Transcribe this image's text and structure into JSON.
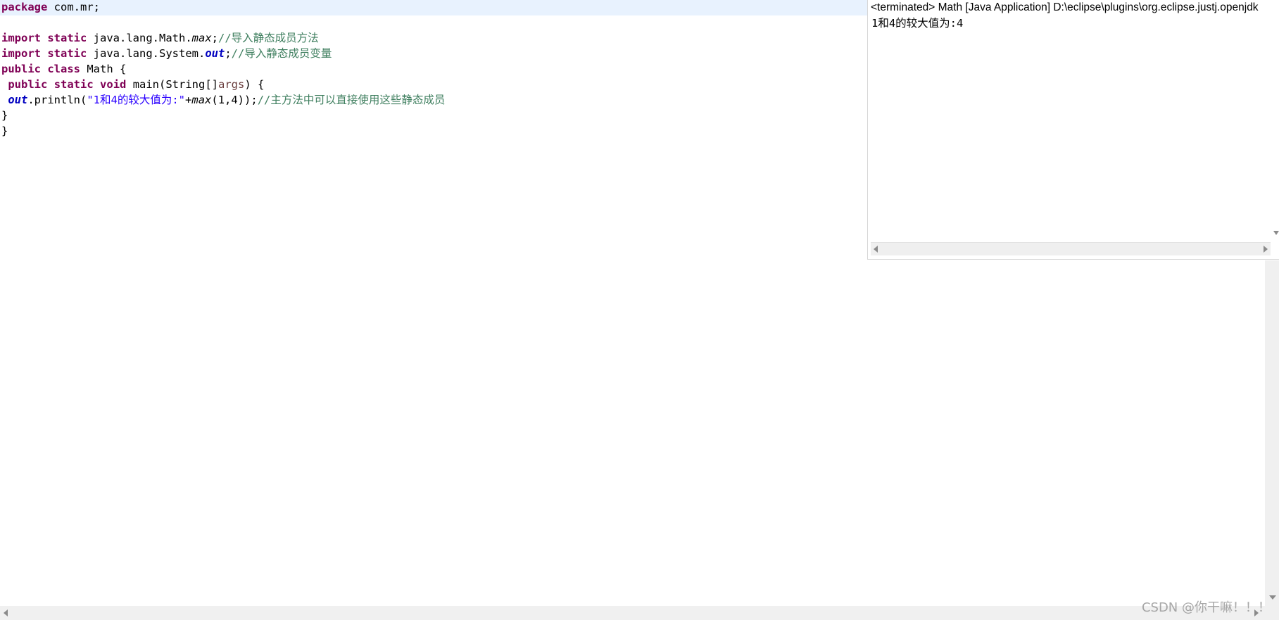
{
  "editor": {
    "lines": [
      [
        {
          "text": "package",
          "cls": "kw"
        },
        {
          "text": " com.mr;",
          "cls": ""
        }
      ],
      [],
      [
        {
          "text": "import",
          "cls": "kw"
        },
        {
          "text": " ",
          "cls": ""
        },
        {
          "text": "static",
          "cls": "kw"
        },
        {
          "text": " java.lang.Math.",
          "cls": ""
        },
        {
          "text": "max",
          "cls": "mth"
        },
        {
          "text": ";",
          "cls": ""
        },
        {
          "text": "//导入静态成员方法",
          "cls": "cmt"
        }
      ],
      [
        {
          "text": "import",
          "cls": "kw"
        },
        {
          "text": " ",
          "cls": ""
        },
        {
          "text": "static",
          "cls": "kw"
        },
        {
          "text": " java.lang.System.",
          "cls": ""
        },
        {
          "text": "out",
          "cls": "fld"
        },
        {
          "text": ";",
          "cls": ""
        },
        {
          "text": "//导入静态成员变量",
          "cls": "cmt"
        }
      ],
      [
        {
          "text": "public",
          "cls": "kw"
        },
        {
          "text": " ",
          "cls": ""
        },
        {
          "text": "class",
          "cls": "kw"
        },
        {
          "text": " Math {",
          "cls": ""
        }
      ],
      [
        {
          "text": " ",
          "cls": ""
        },
        {
          "text": "public",
          "cls": "kw"
        },
        {
          "text": " ",
          "cls": ""
        },
        {
          "text": "static",
          "cls": "kw"
        },
        {
          "text": " ",
          "cls": ""
        },
        {
          "text": "void",
          "cls": "kw"
        },
        {
          "text": " main(String[]",
          "cls": ""
        },
        {
          "text": "args",
          "cls": "param"
        },
        {
          "text": ") {",
          "cls": ""
        }
      ],
      [
        {
          "text": " ",
          "cls": ""
        },
        {
          "text": "out",
          "cls": "fld"
        },
        {
          "text": ".println(",
          "cls": ""
        },
        {
          "text": "\"1和4的较大值为:\"",
          "cls": "str"
        },
        {
          "text": "+",
          "cls": ""
        },
        {
          "text": "max",
          "cls": "mth"
        },
        {
          "text": "(1,4));",
          "cls": ""
        },
        {
          "text": "//主方法中可以直接使用这些静态成员",
          "cls": "cmt"
        }
      ],
      [
        {
          "text": "}",
          "cls": ""
        }
      ],
      [
        {
          "text": "}",
          "cls": ""
        }
      ]
    ]
  },
  "console": {
    "title": "<terminated> Math [Java Application] D:\\eclipse\\plugins\\org.eclipse.justj.openjdk",
    "output": "1和4的较大值为:4"
  },
  "watermark": "CSDN @你干嘛！！！",
  "colors": {
    "keyword": "#7f0055",
    "static_field": "#0000c0",
    "string": "#2a00ff",
    "comment": "#3f7f5f",
    "parameter": "#6a3e3e",
    "current_line": "#e8f2fe"
  }
}
